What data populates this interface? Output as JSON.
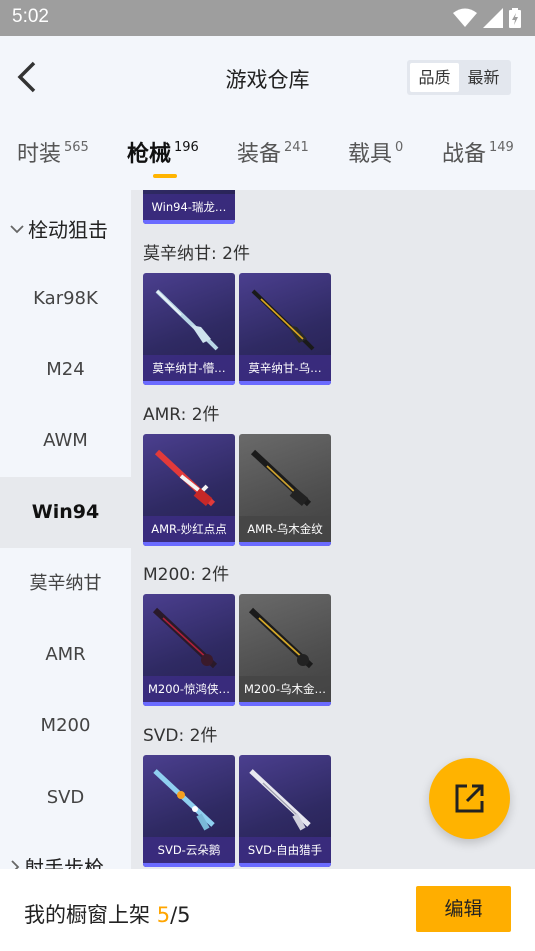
{
  "status_bar": {
    "time": "5:02"
  },
  "header": {
    "title": "游戏仓库",
    "sort_options": [
      "品质",
      "最新"
    ]
  },
  "tabs": [
    {
      "label": "时装",
      "count": "565"
    },
    {
      "label": "枪械",
      "count": "196"
    },
    {
      "label": "装备",
      "count": "241"
    },
    {
      "label": "载具",
      "count": "0"
    },
    {
      "label": "战备",
      "count": "149"
    }
  ],
  "sidebar": {
    "group": "栓动狙击",
    "items": [
      "Kar98K",
      "M24",
      "AWM",
      "Win94",
      "莫辛纳甘",
      "AMR",
      "M200",
      "SVD"
    ],
    "next_group": "射手步枪"
  },
  "sections": [
    {
      "title": "莫辛纳甘: 2件",
      "items": [
        "莫辛纳甘-懵…",
        "莫辛纳甘-乌…"
      ]
    },
    {
      "title": "AMR: 2件",
      "items": [
        "AMR-妙红点点",
        "AMR-乌木金纹"
      ]
    },
    {
      "title": "M200: 2件",
      "items": [
        "M200-惊鸿侠…",
        "M200-乌木金…"
      ]
    },
    {
      "title": "SVD: 2件",
      "items": [
        "SVD-云朵鹅",
        "SVD-自由猎手"
      ]
    }
  ],
  "top_partial_item": "Win94-瑞龙…",
  "footer": {
    "label": "我的橱窗上架",
    "current": "5",
    "separator": "/",
    "total": "5",
    "edit_label": "编辑"
  },
  "colors": {
    "accent": "#ffb300",
    "card_purple": "#2f2a63",
    "card_grey": "#4e4e4e"
  }
}
